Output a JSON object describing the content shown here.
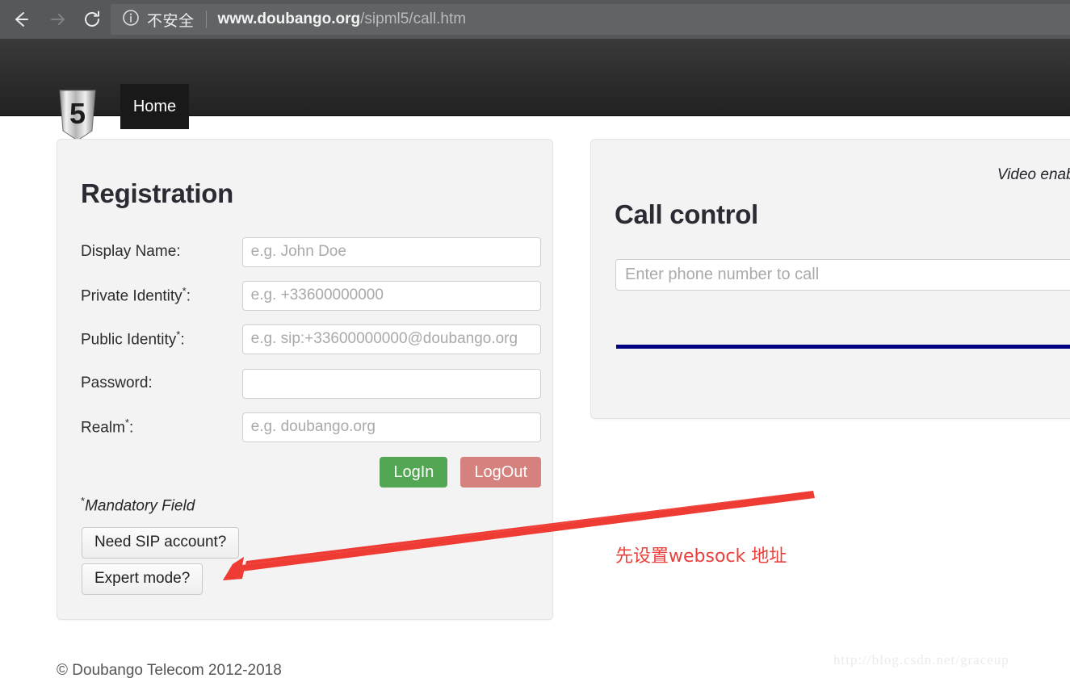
{
  "browser": {
    "back_icon": "back-arrow-icon",
    "forward_icon": "forward-arrow-icon",
    "reload_icon": "reload-icon",
    "info_icon": "info-circle-icon",
    "security_label": "不安全",
    "url_host": "www.doubango.org",
    "url_path": "/sipml5/call.htm",
    "toolbar_color": "#56585a",
    "omnibox_color": "#616365"
  },
  "navbar": {
    "brand_icon": "html5-logo-icon",
    "home_label": "Home",
    "background_color": "#2c2c2c"
  },
  "registration": {
    "title": "Registration",
    "fields": [
      {
        "label": "Display Name:",
        "mandatory": false,
        "placeholder": "e.g. John Doe",
        "value": ""
      },
      {
        "label": "Private Identity",
        "mandatory": true,
        "placeholder": "e.g. +33600000000",
        "value": ""
      },
      {
        "label": "Public Identity",
        "mandatory": true,
        "placeholder": "e.g. sip:+33600000000@doubango.org",
        "value": ""
      },
      {
        "label": "Password:",
        "mandatory": false,
        "placeholder": "",
        "value": ""
      },
      {
        "label": "Realm",
        "mandatory": true,
        "placeholder": "e.g. doubango.org",
        "value": ""
      }
    ],
    "login_label": "LogIn",
    "logout_label": "LogOut",
    "login_color": "#53a653",
    "logout_color": "#d5817e",
    "mandatory_note": "Mandatory Field",
    "need_sip_label": "Need SIP account?",
    "expert_mode_label": "Expert mode?"
  },
  "call_control": {
    "title": "Call control",
    "video_status": "Video enabled",
    "phone_placeholder": "Enter phone number to call",
    "phone_value": "",
    "progress_color": "#000080"
  },
  "annotation": {
    "text": "先设置websock 地址",
    "color": "#e8403a",
    "arrow_icon": "red-arrow-annotation-icon"
  },
  "footer": {
    "copyright": "© Doubango Telecom 2012-2018",
    "watermark": "http://blog.csdn.net/graceup"
  }
}
